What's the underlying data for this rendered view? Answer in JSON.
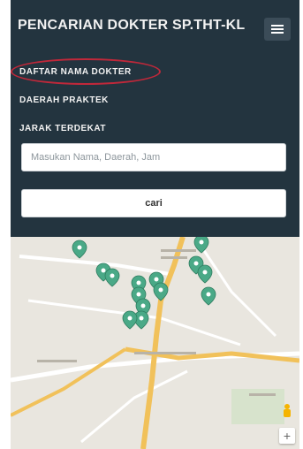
{
  "navbar": {
    "brand": "PENCARIAN DOKTER SP.THT-KL",
    "menu_icon": "hamburger-icon"
  },
  "menu": {
    "items": [
      {
        "label": "DAFTAR NAMA DOKTER",
        "selected": true
      },
      {
        "label": "DAERAH PRAKTEK"
      },
      {
        "label": "JARAK TERDEKAT"
      }
    ]
  },
  "search": {
    "placeholder": "Masukan Nama, Daerah, Jam",
    "value": ""
  },
  "button": {
    "label": "cari"
  },
  "map": {
    "zoom_in_label": "+",
    "marker_color": "#4aa987",
    "marker_count": 14
  }
}
